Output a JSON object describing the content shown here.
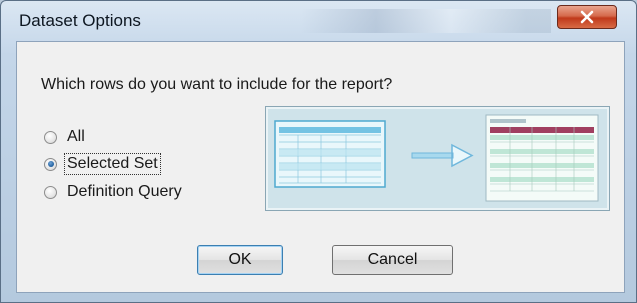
{
  "window": {
    "title": "Dataset Options"
  },
  "dialog": {
    "question": "Which rows do you want to include for the report?",
    "options": [
      {
        "label": "All",
        "checked": false
      },
      {
        "label": "Selected Set",
        "checked": true
      },
      {
        "label": "Definition Query",
        "checked": false
      }
    ],
    "ok_label": "OK",
    "cancel_label": "Cancel"
  },
  "icons": {
    "close": "close-icon",
    "arrow": "arrow-right-icon"
  },
  "colors": {
    "close_button": "#c0391b",
    "selected_row_header": "#a04060",
    "arrow": "#6fb7dc"
  }
}
